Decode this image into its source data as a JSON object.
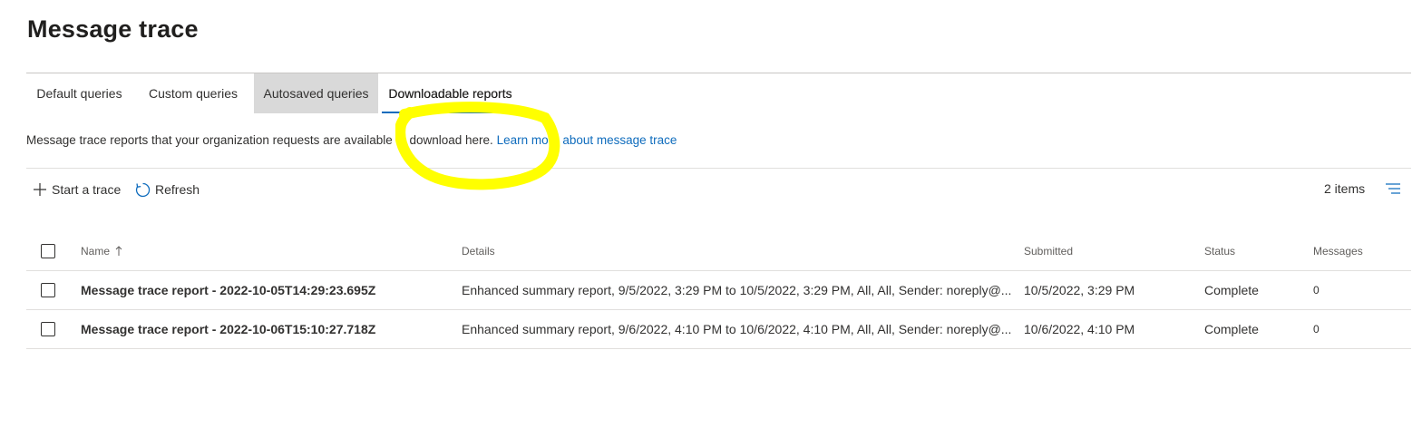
{
  "page": {
    "title": "Message trace"
  },
  "tabs": [
    {
      "label": "Default queries",
      "state": "normal"
    },
    {
      "label": "Custom queries",
      "state": "normal"
    },
    {
      "label": "Autosaved queries",
      "state": "hovered"
    },
    {
      "label": "Downloadable reports",
      "state": "selected"
    }
  ],
  "description": {
    "text": "Message trace reports that your organization requests are available to download here.",
    "link": "Learn more about message trace"
  },
  "toolbar": {
    "start_trace_label": "Start a trace",
    "start_trace_icon": "plus-icon",
    "refresh_label": "Refresh",
    "refresh_icon": "refresh-icon",
    "items_count": "2 items",
    "view_icon": "view-options-icon"
  },
  "table": {
    "columns": {
      "name": "Name",
      "details": "Details",
      "submitted": "Submitted",
      "status": "Status",
      "messages": "Messages"
    },
    "sort_icon": "sort-ascending-icon",
    "rows": [
      {
        "name": "Message trace report - 2022-10-05T14:29:23.695Z",
        "details": "Enhanced summary report, 9/5/2022, 3:29 PM to 10/5/2022, 3:29 PM, All, All, Sender: noreply@...",
        "submitted": "10/5/2022, 3:29 PM",
        "status": "Complete",
        "messages": "0"
      },
      {
        "name": "Message trace report - 2022-10-06T15:10:27.718Z",
        "details": "Enhanced summary report, 9/6/2022, 4:10 PM to 10/6/2022, 4:10 PM, All, All, Sender: noreply@...",
        "submitted": "10/6/2022, 4:10 PM",
        "status": "Complete",
        "messages": "0"
      }
    ]
  },
  "colors": {
    "accent": "#0f6cbd",
    "highlight": "#ffff00",
    "hover_tab": "#d9d9d9"
  }
}
